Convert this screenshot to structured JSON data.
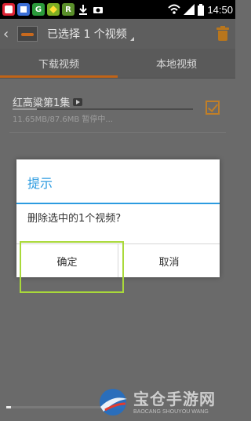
{
  "status_bar": {
    "time": "14:50",
    "icons": [
      "app-icon-1",
      "app-icon-2",
      "app-icon-3",
      "app-icon-4",
      "r-icon",
      "download-icon",
      "camera-icon",
      "wifi-icon",
      "signal-icon",
      "battery-icon"
    ],
    "r_label": "R"
  },
  "action_bar": {
    "title": "已选择 1 个视频"
  },
  "tabs": [
    {
      "label": "下载视频",
      "active": true
    },
    {
      "label": "本地视频",
      "active": false
    }
  ],
  "list": [
    {
      "title": "红高粱第1集",
      "meta": "11.65MB/87.6MB  暂停中...",
      "progress": 0.133,
      "checked": true
    }
  ],
  "dialog": {
    "title": "提示",
    "message": "删除选中的1个视频?",
    "ok_label": "确定",
    "cancel_label": "取消"
  },
  "bottom_progress": 0.04,
  "watermark": {
    "text": "宝仓手游网",
    "sub": "BAOCANG SHOUYOU WANG"
  },
  "colors": {
    "accent_orange": "#c06418",
    "dialog_blue": "#2c9be0",
    "highlight_green": "#a9d93a"
  }
}
